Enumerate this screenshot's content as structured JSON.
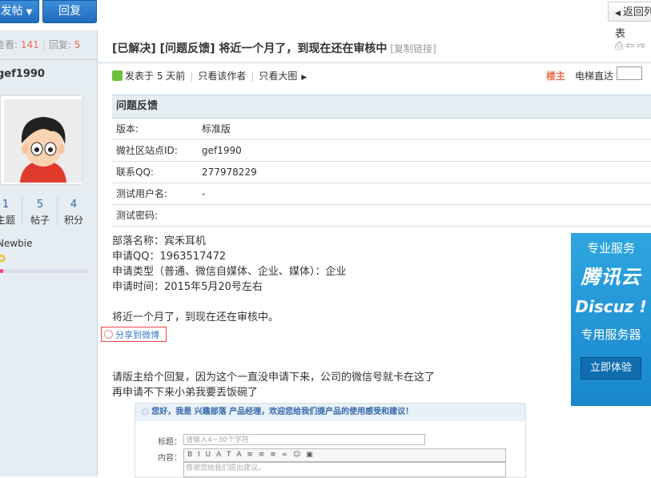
{
  "toolbar": {
    "post_label": "发帖",
    "reply_label": "回复",
    "back_label": "返回列表"
  },
  "thread": {
    "views_label": "查看:",
    "views": "141",
    "replies_label": "回复:",
    "replies": "5",
    "status": "[已解决]",
    "category": "[问题反馈]",
    "title": "将近一个月了，到现在还在审核中",
    "copy_link": "[复制链接]"
  },
  "author": {
    "name": "gef1990",
    "stats": [
      {
        "value": "1",
        "label": "主题"
      },
      {
        "value": "5",
        "label": "帖子"
      },
      {
        "value": "4",
        "label": "积分"
      }
    ],
    "level": "Newbie",
    "level_progress": 0.04
  },
  "post_meta": {
    "posted": "发表于 5 天前",
    "only_author": "只看该作者",
    "big_image": "只看大图",
    "floor_label": "楼主",
    "elevator_label": "电梯直达"
  },
  "info_table": {
    "header": "问题反馈",
    "rows": [
      {
        "key": "版本:",
        "value": "标准版"
      },
      {
        "key": "微社区站点ID:",
        "value": "gef1990"
      },
      {
        "key": "联系QQ:",
        "value": "277978229"
      },
      {
        "key": "测试用户名:",
        "value": "-"
      },
      {
        "key": "测试密码:",
        "value": ""
      }
    ]
  },
  "body": {
    "lines": [
      "部落名称：宾禾耳机",
      "申请QQ：1963517472",
      "申请类型（普通、微信自媒体、企业、媒体）：企业",
      "申请时间：2015年5月20号左右",
      "",
      "将近一个月了，到现在还在审核中。"
    ],
    "share_label": "分享到微博",
    "lines2": [
      "请版主给个回复，因为这个一直没申请下来，公司的微信号就卡在这了",
      "再申请不下来小弟我要丢饭碗了"
    ]
  },
  "embed": {
    "banner": "您好，我是 兴趣部落 产品经理，欢迎您给我们提产品的使用感受和建议！",
    "title_label": "标题：",
    "title_placeholder": "请输入4~30个字符",
    "content_label": "内容：",
    "toolbar": "B I U A T A ≡ ≡ ≡ ∞ ☺ ▣",
    "content_placeholder": "感谢您给我们提出建议。"
  },
  "ad": {
    "line1": "专业服务",
    "line2": "腾讯云",
    "line3": "Discuz !",
    "line4": "专用服务器",
    "cta": "立即体验"
  },
  "colors": {
    "accent_blue": "#1f6bbf",
    "sidebar_bg": "#e5edf2",
    "highlight_red": "#f26c4f",
    "ad_blue": "#1887cc"
  }
}
